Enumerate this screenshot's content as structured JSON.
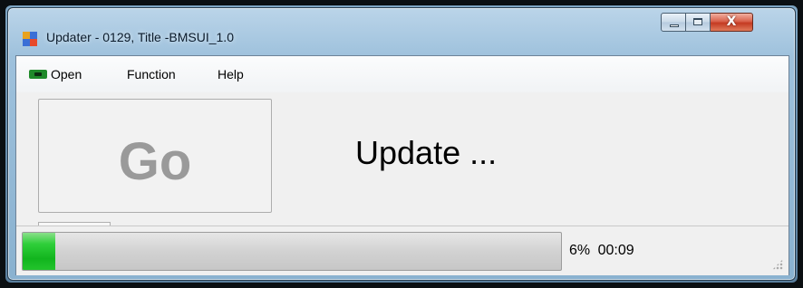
{
  "window": {
    "title": "Updater - 0129,  Title -BMSUI_1.0",
    "close_glyph": "X",
    "icons": {
      "app": "updater-app-icon",
      "minimize": "minimize-icon",
      "maximize": "maximize-icon",
      "close": "close-icon"
    }
  },
  "menu": {
    "open_label": "Open",
    "open_icon": "open-plug-icon",
    "function_label": "Function",
    "help_label": "Help"
  },
  "main": {
    "go_label": "Go",
    "status_text": "Update ..."
  },
  "statusbar": {
    "progress_percent": 6,
    "progress_label": "6%",
    "elapsed": "00:09",
    "progress_color": "#22c42c"
  }
}
